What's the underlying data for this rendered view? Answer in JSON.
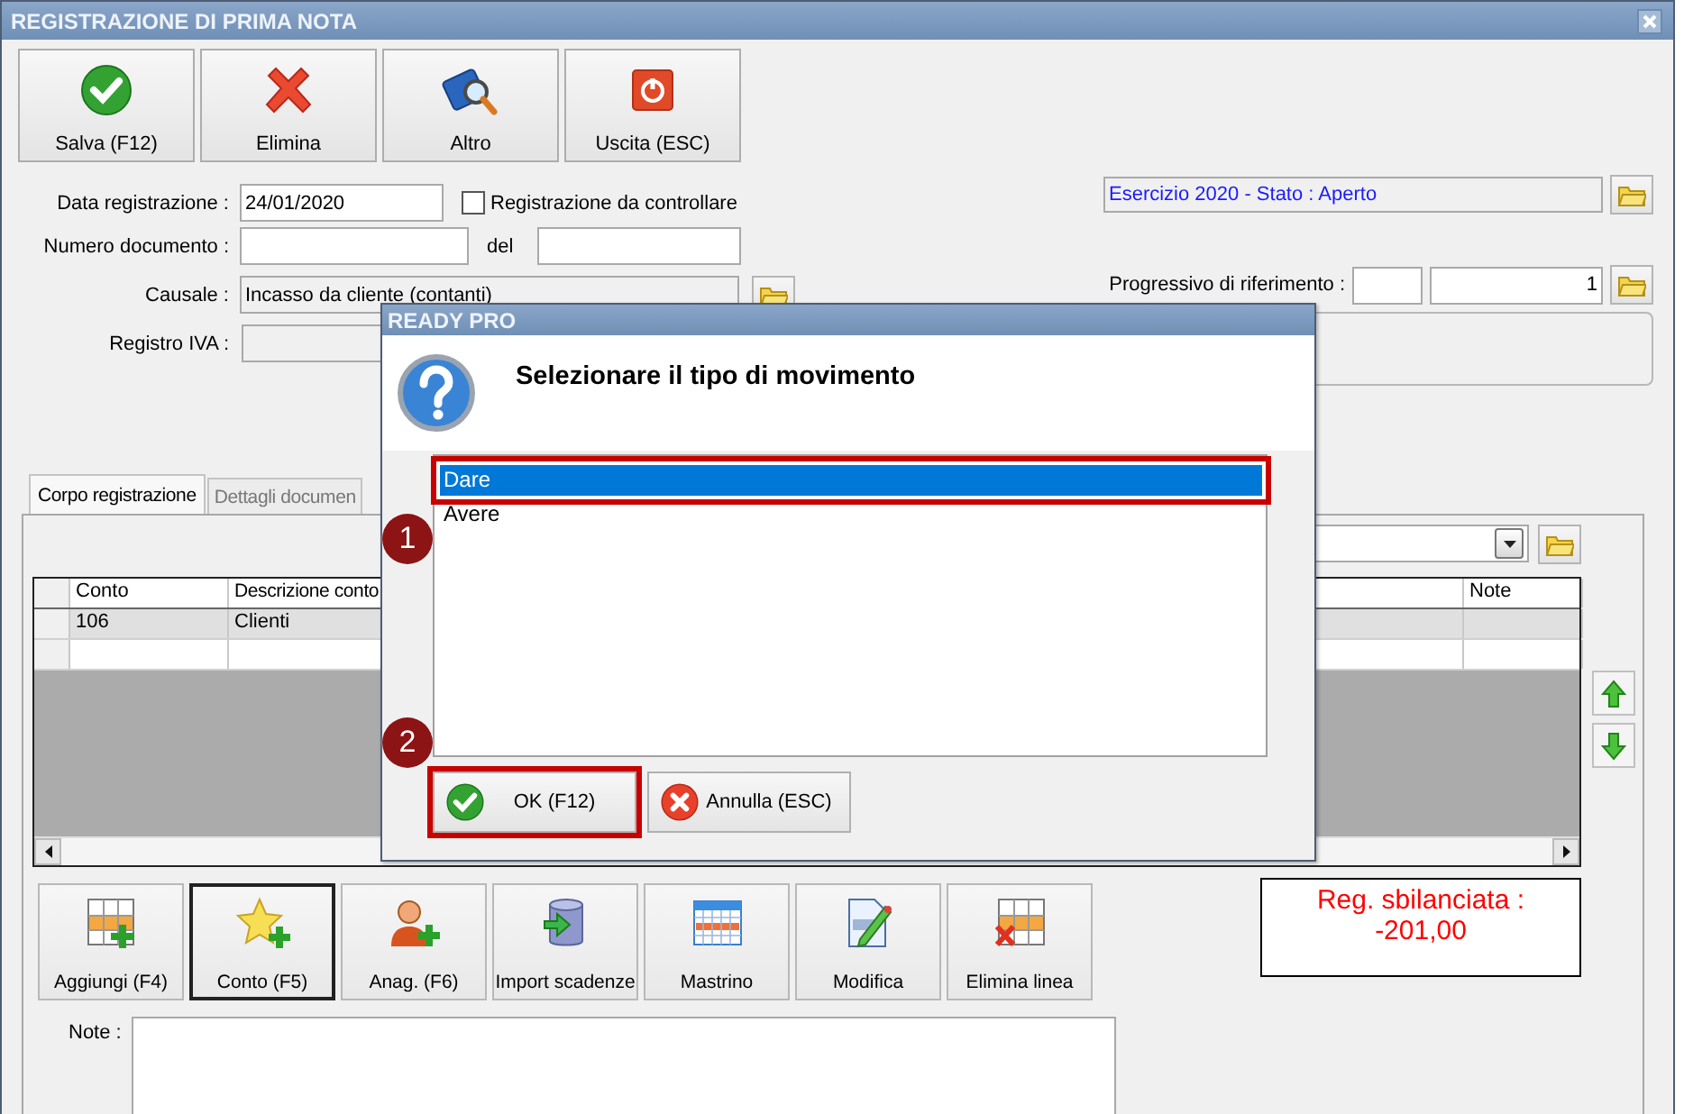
{
  "window": {
    "title": "REGISTRAZIONE DI PRIMA NOTA"
  },
  "toolbar": [
    {
      "label": "Salva (F12)",
      "kind": "save"
    },
    {
      "label": "Elimina",
      "kind": "delete"
    },
    {
      "label": "Altro",
      "kind": "search"
    },
    {
      "label": "Uscita (ESC)",
      "kind": "exit"
    }
  ],
  "form": {
    "date": {
      "label": "Data registrazione :",
      "value": "24/01/2020"
    },
    "to_check": {
      "label": "Registrazione da controllare",
      "checked": false
    },
    "doc_number": {
      "label": "Numero documento :"
    },
    "doc_date": {
      "label": "del"
    },
    "reason": {
      "label": "Causale :",
      "value": "Incasso da cliente (contanti)"
    },
    "vat_register": {
      "label": "Registro IVA :"
    },
    "fiscal_year": {
      "value": "Esercizio 2020 - Stato : Aperto"
    },
    "reference": {
      "label": "Progressivo di riferimento :",
      "value": "1"
    }
  },
  "tabs": [
    {
      "label": "Corpo registrazione",
      "selected": true
    },
    {
      "label": "Dettagli documen",
      "selected": false
    }
  ],
  "table": {
    "columns": [
      "Conto",
      "Descrizione conto",
      "Note"
    ],
    "rows": [
      {
        "cells": [
          "106",
          "Clienti"
        ],
        "selected": true
      },
      {
        "selected": false
      }
    ]
  },
  "actions": [
    {
      "label": "Aggiungi (F4)",
      "kind": "add-row",
      "focused": false
    },
    {
      "label": "Conto (F5)",
      "kind": "star",
      "focused": true
    },
    {
      "label": "Anag. (F6)",
      "kind": "person",
      "focused": false
    },
    {
      "label": "Import scadenze",
      "kind": "database",
      "focused": false
    },
    {
      "label": "Mastrino",
      "kind": "calendar",
      "focused": false
    },
    {
      "label": "Modifica",
      "kind": "edit",
      "focused": false
    },
    {
      "label": "Elimina linea",
      "kind": "delete-row",
      "focused": false
    }
  ],
  "balance": {
    "label": "Reg. sbilanciata :",
    "value": "-201,00"
  },
  "notes": {
    "label": "Note :"
  },
  "dialog": {
    "title": "READY PRO",
    "message": "Selezionare il tipo di movimento",
    "options": [
      {
        "label": "Dare",
        "selected": true,
        "highlighted": true
      },
      {
        "label": "Avere",
        "selected": false,
        "highlighted": false
      }
    ],
    "buttons": [
      {
        "label": "OK (F12)",
        "kind": "ok",
        "highlighted": true
      },
      {
        "label": "Annulla (ESC)",
        "kind": "cancel",
        "highlighted": false
      }
    ]
  },
  "annotations": [
    {
      "label": "1"
    },
    {
      "label": "2"
    }
  ]
}
